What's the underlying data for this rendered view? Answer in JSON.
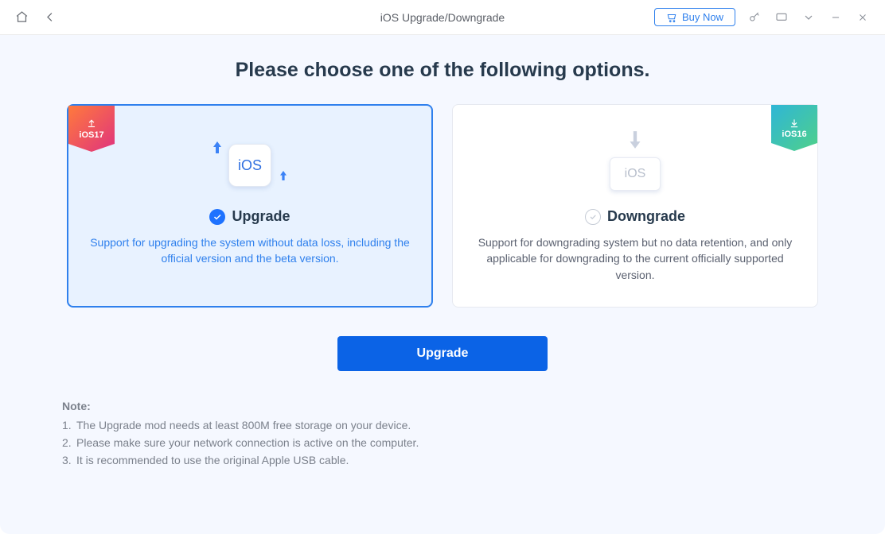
{
  "titlebar": {
    "title": "iOS Upgrade/Downgrade",
    "buy_label": "Buy Now"
  },
  "heading": "Please choose one of the following options.",
  "cards": {
    "upgrade": {
      "ribbon": "iOS17",
      "ios_label": "iOS",
      "title": "Upgrade",
      "desc": "Support for upgrading the system without data loss, including the official version and the beta version."
    },
    "downgrade": {
      "ribbon": "iOS16",
      "ios_label": "iOS",
      "title": "Downgrade",
      "desc": "Support for downgrading system but no data retention, and only applicable for downgrading to the current officially supported version."
    }
  },
  "primary_button": "Upgrade",
  "notes": {
    "title": "Note:",
    "items": [
      "The Upgrade mod needs at least 800M free storage on your device.",
      "Please make sure your network connection is active on the computer.",
      "It is recommended to use the original Apple USB cable."
    ]
  }
}
